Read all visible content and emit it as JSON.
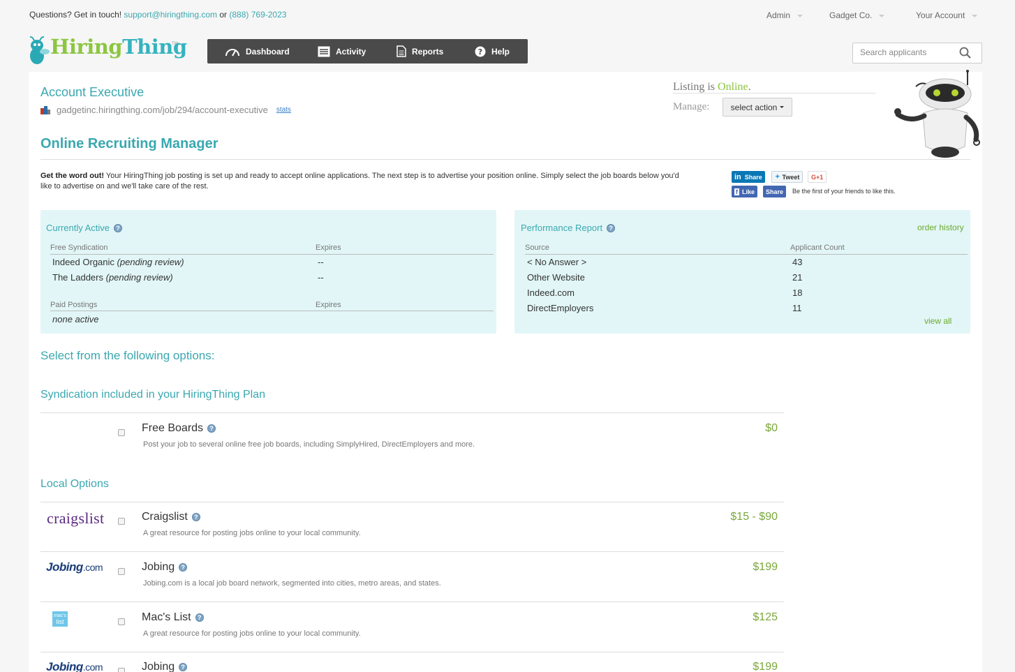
{
  "topbar": {
    "contact_prefix": "Questions? Get in touch!",
    "email": "support@hiringthing.com",
    "or": "or",
    "phone": "(888) 769-2023",
    "menus": [
      "Admin",
      "Gadget Co.",
      "Your Account"
    ]
  },
  "logo": {
    "hiring": "Hiring",
    "thing": "Thing",
    "tm": "TM"
  },
  "nav": {
    "dashboard": "Dashboard",
    "activity": "Activity",
    "reports": "Reports",
    "help": "Help"
  },
  "search": {
    "placeholder": "Search applicants"
  },
  "job": {
    "title": "Account Executive",
    "url": "gadgetinc.hiringthing.com/job/294/account-executive",
    "stats_label": "stats"
  },
  "listing": {
    "prefix": "Listing is",
    "status": "Online",
    "suffix": ".",
    "manage_label": "Manage:",
    "select_action": "select action"
  },
  "orm": {
    "title": "Online Recruiting Manager",
    "intro_bold": "Get the word out!",
    "intro_text": " Your HiringThing job posting is set up and ready to accept online applications. The next step is to advertise your position online. Simply select the job boards below you'd like to advertise on and we'll take care of the rest."
  },
  "social": {
    "linkedin_share": "Share",
    "tweet": "Tweet",
    "gplus": "G+1",
    "fb_like": "Like",
    "fb_share": "Share",
    "fb_note": "Be the first of your friends to like this."
  },
  "currently_active": {
    "title": "Currently Active",
    "free_header": "Free Syndication",
    "expires_header": "Expires",
    "free_rows": [
      {
        "name": "Indeed Organic",
        "note": "(pending review)",
        "expires": "--"
      },
      {
        "name": "The Ladders",
        "note": "(pending review)",
        "expires": "--"
      }
    ],
    "paid_header": "Paid Postings",
    "paid_expires_header": "Expires",
    "paid_none": "none active"
  },
  "performance": {
    "title": "Performance Report",
    "order_history": "order history",
    "source_header": "Source",
    "count_header": "Applicant Count",
    "rows": [
      {
        "source": "< No Answer >",
        "count": "43"
      },
      {
        "source": "Other Website",
        "count": "21"
      },
      {
        "source": "Indeed.com",
        "count": "18"
      },
      {
        "source": "DirectEmployers",
        "count": "11"
      }
    ],
    "view_all": "view all"
  },
  "options": {
    "title": "Select from the following options:",
    "syndication_title": "Syndication included in your HiringThing Plan",
    "free_boards": {
      "name": "Free Boards",
      "desc": "Post your job to several online free job boards, including SimplyHired, DirectEmployers and more.",
      "price": "$0"
    },
    "local_title": "Local Options",
    "local": [
      {
        "logo": "craigslist",
        "name": "Craigslist",
        "desc": "A great resource for posting jobs online to your local community.",
        "price": "$15 - $90"
      },
      {
        "logo_main": "Jobing",
        "logo_com": ".com",
        "name": "Jobing",
        "desc": "Jobing.com is a local job board network, segmented into cities, metro areas, and states.",
        "price": "$199"
      },
      {
        "logo_top": "mac's",
        "logo_bottom": "list",
        "name": "Mac's List",
        "desc": "A great resource for posting jobs online to your local community.",
        "price": "$125"
      },
      {
        "logo_main": "Jobing",
        "logo_com": ".com",
        "name": "Jobing",
        "price": "$199"
      }
    ]
  },
  "colors": {
    "teal": "#3aa8b0",
    "green": "#8cc63f",
    "price_green": "#7aa83a",
    "nav_bg": "#4a4a4a",
    "box_bg": "#e2f6f7"
  }
}
